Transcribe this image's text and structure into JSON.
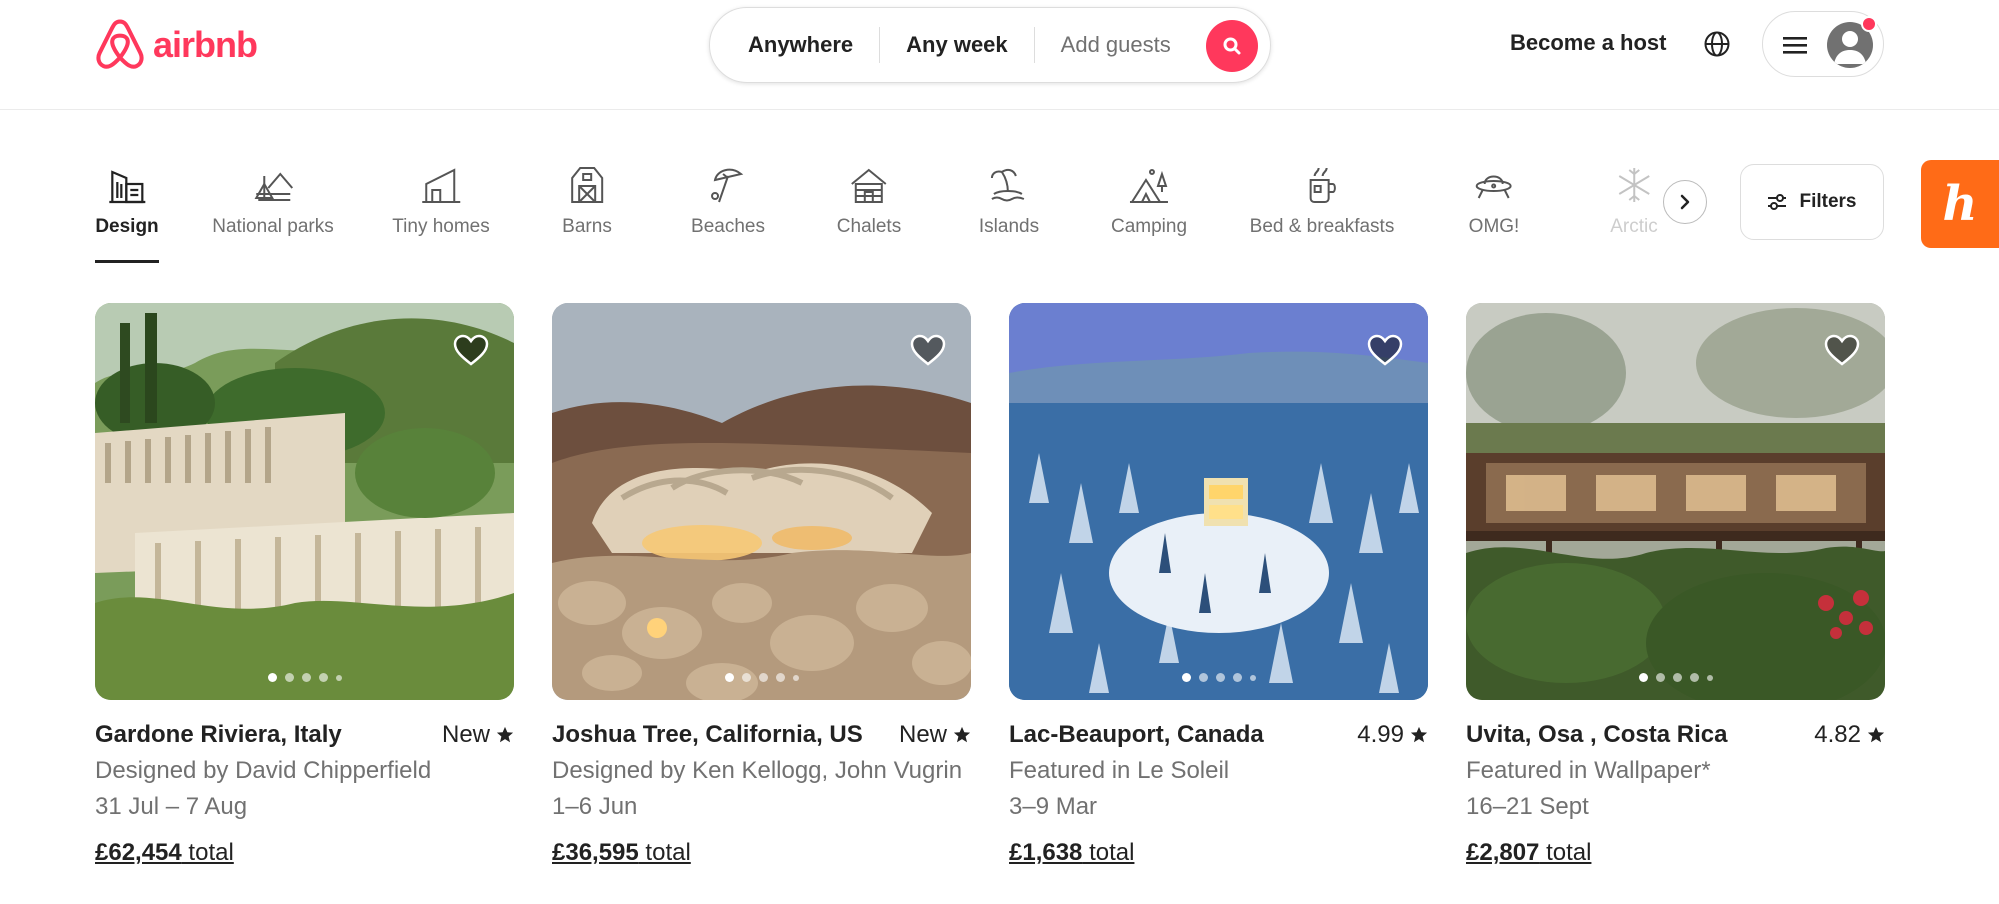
{
  "header": {
    "logo_text": "airbnb",
    "search": {
      "where": "Anywhere",
      "when": "Any week",
      "guests_placeholder": "Add guests"
    },
    "host_label": "Become a host",
    "brand_color": "#ff385c"
  },
  "categories": [
    {
      "label": "Design",
      "icon": "design-icon",
      "active": true
    },
    {
      "label": "National parks",
      "icon": "national-parks-icon"
    },
    {
      "label": "Tiny homes",
      "icon": "tiny-home-icon"
    },
    {
      "label": "Barns",
      "icon": "barn-icon"
    },
    {
      "label": "Beaches",
      "icon": "beach-umbrella-icon"
    },
    {
      "label": "Chalets",
      "icon": "chalet-icon"
    },
    {
      "label": "Islands",
      "icon": "island-icon"
    },
    {
      "label": "Camping",
      "icon": "camping-icon"
    },
    {
      "label": "Bed & breakfasts",
      "icon": "coffee-icon"
    },
    {
      "label": "OMG!",
      "icon": "ufo-icon"
    },
    {
      "label": "Arctic",
      "icon": "snowflake-icon"
    }
  ],
  "filters_label": "Filters",
  "honey_extension_label": "h",
  "listings": [
    {
      "location": "Gardone Riviera, Italy",
      "rating": "New",
      "subtitle": "Designed by David Chipperfield",
      "dates": "31 Jul – 7 Aug",
      "price": "£62,454",
      "price_suffix": " total"
    },
    {
      "location": "Joshua Tree, California, US",
      "rating": "New",
      "subtitle": "Designed by Ken Kellogg, John Vugrin",
      "dates": "1–6 Jun",
      "price": "£36,595",
      "price_suffix": " total"
    },
    {
      "location": "Lac-Beauport, Canada",
      "rating": "4.99",
      "subtitle": "Featured in Le Soleil",
      "dates": "3–9 Mar",
      "price": "£1,638",
      "price_suffix": " total"
    },
    {
      "location": "Uvita, Osa , Costa Rica",
      "rating": "4.82",
      "subtitle": "Featured in Wallpaper*",
      "dates": "16–21 Sept",
      "price": "£2,807",
      "price_suffix": " total"
    }
  ]
}
